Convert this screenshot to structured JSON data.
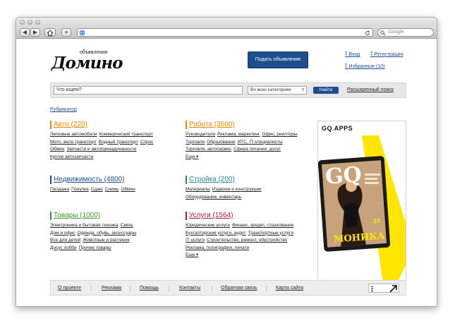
{
  "browser": {
    "search_placeholder": "Google"
  },
  "header": {
    "logo_sup": "объявления",
    "logo": "Домино",
    "post_button": "Подать объявление",
    "login": "Вход",
    "register": "Регистрация",
    "favorites": "Избранные (10)"
  },
  "search": {
    "query_placeholder": "Что ищем?",
    "category_selected": "Во всех категориях",
    "find_button": "Найти",
    "advanced": "Расширенный поиск"
  },
  "rubricator": "Рубрикатор",
  "categories": {
    "auto": {
      "title": "Авто (220)",
      "color": "#e08a00",
      "rows": [
        [
          "Легковые автомобили",
          "Коммерческий транспорт"
        ],
        [
          "Мото, вело транспорт",
          "Водный транспорт",
          "Спрос"
        ],
        [
          "Обмен",
          "Запчасти и автопринадлежности"
        ],
        [
          "Куплю автозапчасти"
        ]
      ]
    },
    "work": {
      "title": "Работа (3600)",
      "color": "#e08a00",
      "rows": [
        [
          "Руководители",
          "Реклама, маркетинг",
          "Офис, риелторы"
        ],
        [
          "Торговля",
          "Образование",
          "ИТС, IT-специалисты"
        ],
        [
          "Торговля, автосервис",
          "Сфера питания, досуг"
        ],
        [
          "Еще ▾"
        ]
      ]
    },
    "realty": {
      "title": "Недвижимость (4800)",
      "color": "#1f4f91",
      "rows": [
        [
          "Продажа",
          "Покупка",
          "Сдаю",
          "Сниму",
          "Обмен"
        ]
      ]
    },
    "build": {
      "title": "Стройка (200)",
      "color": "#2a8a8a",
      "rows": [
        [
          "Материалы",
          "Изделия и конструкции"
        ],
        [
          "Оборудование, инвентарь"
        ]
      ]
    },
    "goods": {
      "title": "Товары (1000)",
      "color": "#3e9a2e",
      "rows": [
        [
          "Электроника и бытовая техника",
          "Связь"
        ],
        [
          "Дом и офис",
          "Одежда, обувь, аксессуары"
        ],
        [
          "Все для детей",
          "Животные и растения"
        ],
        [
          "Досуг, хобби",
          "Прочие товары"
        ]
      ]
    },
    "services": {
      "title": "Услуги (1564)",
      "color": "#c0142f",
      "rows": [
        [
          "Юридические услуги",
          "Финанс, кредит, страхование"
        ],
        [
          "Бухгалтерские услуги, аудит",
          "Транспортные услуги"
        ],
        [
          "IT-услуги",
          "Строительство, ремонт, обустройство"
        ],
        [
          "Реклама, полиграфия, печати"
        ],
        [
          "Еще ▾"
        ]
      ]
    }
  },
  "ad": {
    "label": "GQ APPS",
    "magazine": "GQ",
    "cover_name": "МОНИКА",
    "issue": "10",
    "accent": "#ffe600"
  },
  "footer": {
    "links": [
      "О проекте",
      "Реклама",
      "Помощь",
      "Контакты",
      "Обратная связь",
      "Карта сайта"
    ]
  }
}
